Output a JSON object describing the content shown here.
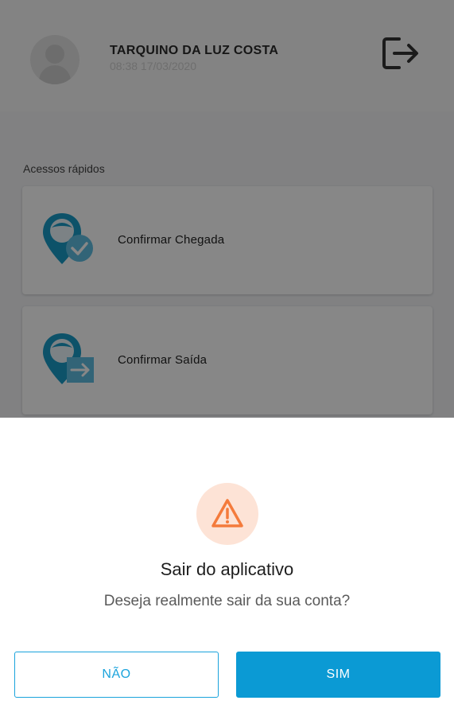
{
  "user": {
    "name": "TARQUINO DA LUZ COSTA",
    "datetime": "08:38 17/03/2020"
  },
  "header": {
    "logout_icon": "logout-icon"
  },
  "quick_access": {
    "label": "Acessos rápidos",
    "items": [
      {
        "label": "Confirmar Chegada",
        "icon": "location-check-icon"
      },
      {
        "label": "Confirmar Saída",
        "icon": "location-exit-icon"
      }
    ]
  },
  "dialog": {
    "icon": "warning-icon",
    "title": "Sair do aplicativo",
    "message": "Deseja realmente sair da sua conta?",
    "cancel_label": "NÃO",
    "confirm_label": "SIM"
  },
  "colors": {
    "accent": "#0b9ad4",
    "warning": "#f47b3c",
    "warning_bg": "#fde3d6",
    "icon_teal": "#1a9cc6"
  }
}
